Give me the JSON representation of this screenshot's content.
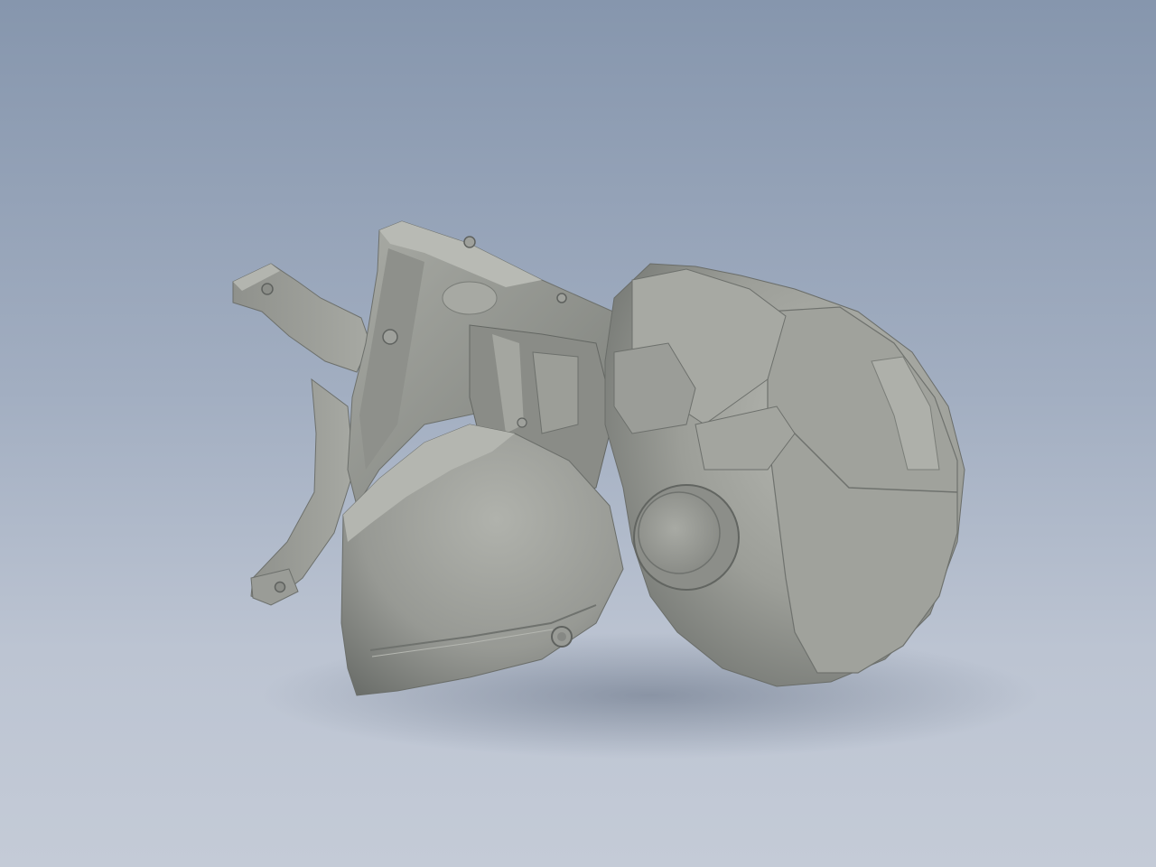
{
  "viewer": {
    "background_top": "#8696ad",
    "background_bottom": "#c4cbd7",
    "model_color": "#9a9c96",
    "model_shadow_color": "#5f625f"
  },
  "model": {
    "name": "",
    "icon": "3d-model-bust"
  }
}
